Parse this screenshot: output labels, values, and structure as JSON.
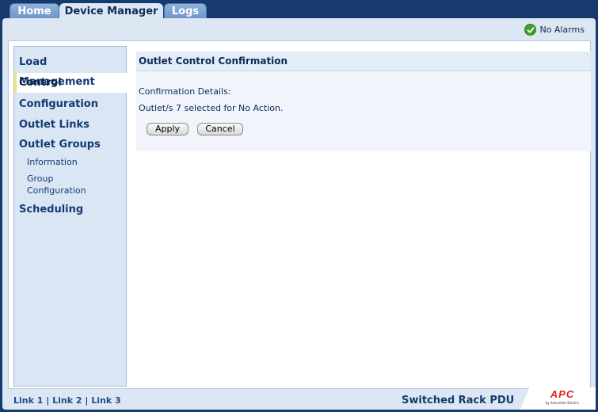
{
  "tabs": [
    {
      "label": "Home",
      "active": false
    },
    {
      "label": "Device Manager",
      "active": true
    },
    {
      "label": "Logs",
      "active": false
    }
  ],
  "status": {
    "alarms_label": "No Alarms",
    "icon": "check-icon",
    "color": "#3aa32c"
  },
  "sidebar": {
    "items": [
      {
        "label": "Load Management"
      },
      {
        "label": "Control",
        "selected": true
      },
      {
        "label": "Configuration"
      },
      {
        "label": "Outlet Links"
      },
      {
        "label": "Outlet Groups"
      }
    ],
    "subitems": [
      {
        "label": "Information"
      },
      {
        "label": "Group"
      },
      {
        "label": "Configuration"
      }
    ],
    "scheduling_label": "Scheduling"
  },
  "content": {
    "title": "Outlet Control Confirmation",
    "details_label": "Confirmation Details:",
    "details_text": "Outlet/s 7 selected for No Action.",
    "apply_label": "Apply",
    "cancel_label": "Cancel"
  },
  "footer": {
    "links": [
      "Link 1",
      "Link 2",
      "Link 3"
    ],
    "separator": "|",
    "product": "Switched Rack PDU",
    "logo_text": "APC",
    "logo_sub": "by Schneider Electric"
  },
  "colors": {
    "frame_bg": "#dde7f3",
    "page_bg": "#163a6e",
    "accent": "#123b73",
    "logo_red": "#e1241d"
  }
}
